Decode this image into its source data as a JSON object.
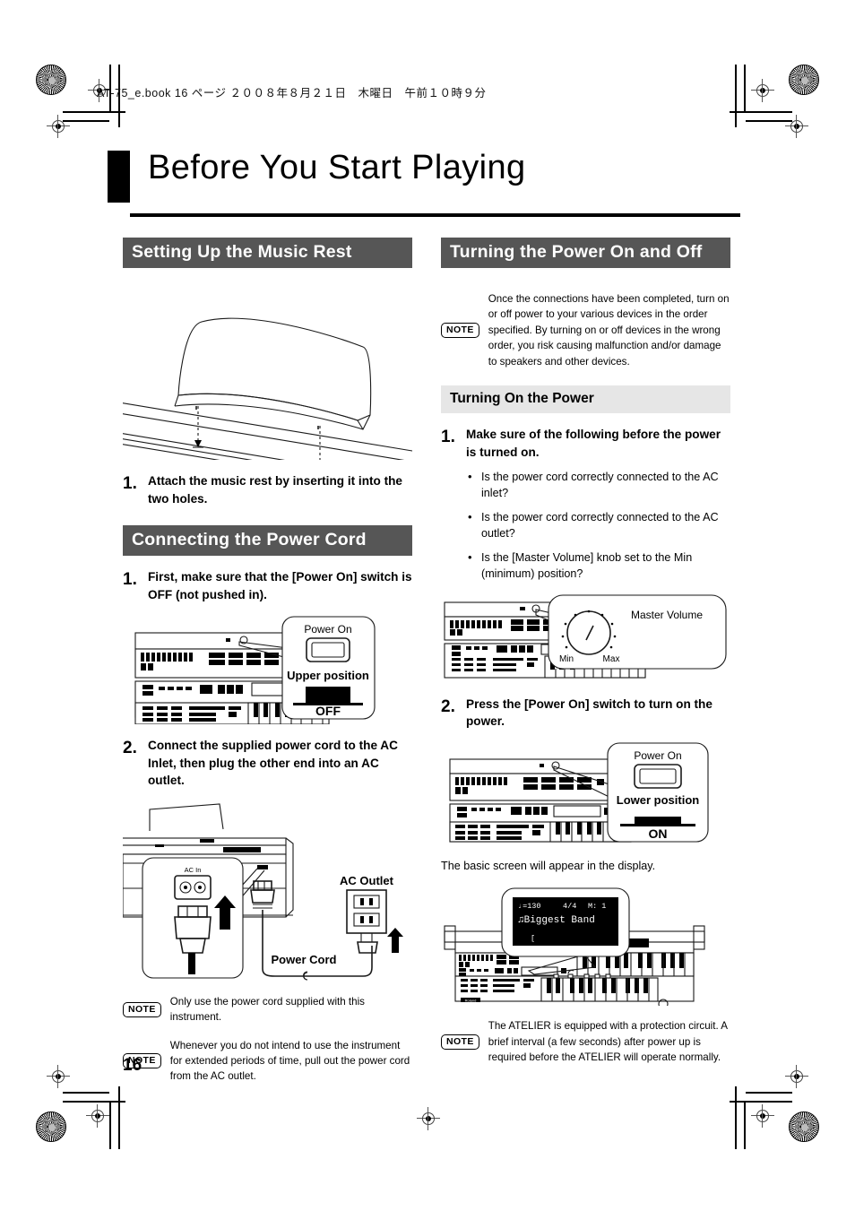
{
  "page": {
    "file_stamp": "AT-75_e.book  16 ページ  ２００８年８月２１日　木曜日　午前１０時９分",
    "title": "Before You Start Playing",
    "page_number": "16"
  },
  "left_column": {
    "section1": {
      "heading": "Setting Up the Music Rest",
      "figure_name": "music-rest-illustration",
      "step1": {
        "num": "1.",
        "text": "Attach the music rest by inserting it into the two holes."
      }
    },
    "section2": {
      "heading": "Connecting the Power Cord",
      "step1": {
        "num": "1.",
        "text": "First, make sure that the [Power On] switch is OFF (not pushed in)."
      },
      "callout": {
        "title": "Power On",
        "position_label": "Upper position",
        "state_label": "OFF"
      },
      "step2": {
        "num": "2.",
        "text": "Connect the supplied power cord to the AC Inlet, then plug the other end into an AC outlet."
      },
      "cord_figure": {
        "ac_in_label": "AC In",
        "ac_outlet_label": "AC Outlet",
        "power_cord_label": "Power Cord"
      },
      "notes": [
        {
          "badge": "NOTE",
          "text": "Only use the power cord supplied with this instrument."
        },
        {
          "badge": "NOTE",
          "text": "Whenever you do not intend to use the instrument for extended periods of time, pull out the power cord from the AC outlet."
        }
      ]
    }
  },
  "right_column": {
    "heading": "Turning the Power On and Off",
    "intro_note": {
      "badge": "NOTE",
      "text": "Once the connections have been completed, turn on or off power to your various devices in the order specified. By turning on or off devices in the wrong order, you risk causing malfunction and/or damage to speakers and other devices."
    },
    "subheading": "Turning On the Power",
    "step1": {
      "num": "1.",
      "text": "Make sure of the following before the power is turned on.",
      "checks": [
        "Is the power cord correctly connected to the AC inlet?",
        "Is the power cord correctly connected to the AC outlet?",
        "Is the [Master Volume] knob set to the Min (minimum) position?"
      ]
    },
    "volume_figure": {
      "title": "Master Volume",
      "min_label": "Min",
      "max_label": "Max"
    },
    "step2": {
      "num": "2.",
      "text": "Press the [Power On] switch to turn on the power."
    },
    "callout": {
      "title": "Power On",
      "position_label": "Lower position",
      "state_label": "ON"
    },
    "after_text": "The basic screen will appear in the display.",
    "display_figure": {
      "lcd_line1_tempo": "♩=130",
      "lcd_line1_beat": "4/4",
      "lcd_line1_measure": "M: 1",
      "lcd_line2": "Biggest Band",
      "lcd_line3": "[",
      "brand": "Roland"
    },
    "note": {
      "badge": "NOTE",
      "text": "The ATELIER is equipped with a protection circuit. A brief interval (a few seconds) after power up is required before the ATELIER will operate normally."
    }
  },
  "colors": {
    "section_heading_bg": "#565656",
    "subheading_bg": "#e6e6e6",
    "ink": "#000000"
  }
}
